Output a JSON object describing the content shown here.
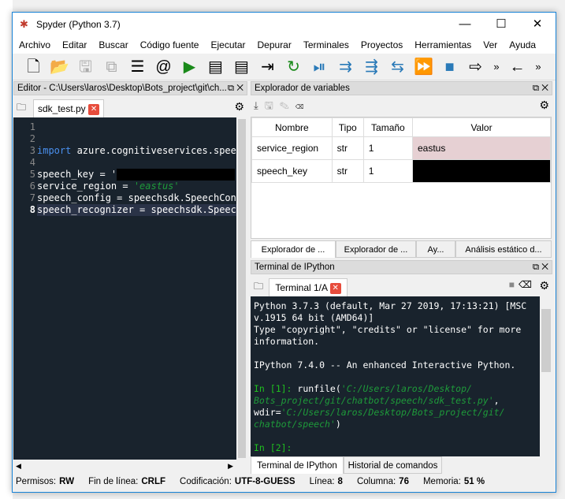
{
  "window": {
    "title": "Spyder (Python 3.7)"
  },
  "menu": [
    "Archivo",
    "Editar",
    "Buscar",
    "Código fuente",
    "Ejecutar",
    "Depurar",
    "Terminales",
    "Proyectos",
    "Herramientas",
    "Ver",
    "Ayuda"
  ],
  "toolbar": [
    {
      "icon": "new-file-icon",
      "glyph": "🗋"
    },
    {
      "icon": "open-folder-icon",
      "glyph": "📂"
    },
    {
      "icon": "save-icon",
      "glyph": "🖫"
    },
    {
      "icon": "save-all-icon",
      "glyph": "⧉"
    },
    {
      "icon": "list-icon",
      "glyph": "☰"
    },
    {
      "icon": "at-icon",
      "glyph": "@"
    },
    {
      "icon": "run-icon",
      "glyph": "▶"
    },
    {
      "icon": "run-cell-icon",
      "glyph": "▤"
    },
    {
      "icon": "run-cell-advance-icon",
      "glyph": "▤"
    },
    {
      "icon": "run-selection-icon",
      "glyph": "⇥"
    },
    {
      "icon": "rerun-icon",
      "glyph": "↻"
    },
    {
      "icon": "debug-icon",
      "glyph": "⏯"
    },
    {
      "icon": "step-icon",
      "glyph": "⇉"
    },
    {
      "icon": "step-into-icon",
      "glyph": "⇶"
    },
    {
      "icon": "step-return-icon",
      "glyph": "⇆"
    },
    {
      "icon": "continue-icon",
      "glyph": "⏩"
    },
    {
      "icon": "stop-icon",
      "glyph": "■"
    },
    {
      "icon": "maximize-pane-icon",
      "glyph": "⇨"
    },
    {
      "icon": "more-icon",
      "glyph": "»"
    },
    {
      "icon": "back-arrow-icon",
      "glyph": "←"
    },
    {
      "icon": "more-icon",
      "glyph": "»"
    }
  ],
  "editor": {
    "header": "Editor - C:\\Users\\laros\\Desktop\\Bots_project\\git\\ch...",
    "tab": "sdk_test.py",
    "lines": [
      {
        "n": "1",
        "code": ""
      },
      {
        "n": "2",
        "code": ""
      },
      {
        "n": "3",
        "kw": "import",
        "code": " azure.cognitiveservices.speec"
      },
      {
        "n": "4",
        "code": ""
      },
      {
        "n": "5",
        "code": "speech_key = '"
      },
      {
        "n": "6",
        "code": "service_region = ",
        "str": "'eastus'"
      },
      {
        "n": "7",
        "code": "speech_config = speechsdk.SpeechConf"
      },
      {
        "n": "8",
        "code": "speech_recognizer = speechsdk.Speech"
      }
    ]
  },
  "varexp": {
    "header": "Explorador de variables",
    "columns": [
      "Nombre",
      "Tipo",
      "Tamaño",
      "Valor"
    ],
    "rows": [
      {
        "name": "service_region",
        "type": "str",
        "size": "1",
        "value": "eastus"
      },
      {
        "name": "speech_key",
        "type": "str",
        "size": "1",
        "value": ""
      }
    ],
    "tabs": [
      "Explorador de ...",
      "Explorador de ...",
      "Ay...",
      "Análisis estático d..."
    ]
  },
  "terminal": {
    "header": "Terminal de IPython",
    "tab": "Terminal 1/A",
    "banner": "Python 3.7.3 (default, Mar 27 2019, 17:13:21) [MSC\nv.1915 64 bit (AMD64)]\nType \"copyright\", \"credits\" or \"license\" for more\ninformation.\n\nIPython 7.4.0 -- An enhanced Interactive Python.\n",
    "in1": "In [1]: ",
    "cmd1": "runfile(",
    "s1": "'C:/Users/laros/Desktop/\nBots_project/git/chatbot/speech/sdk_test.py'",
    "cmd2": ",\nwdir=",
    "s2": "'C:/Users/laros/Desktop/Bots_project/git/\nchatbot/speech'",
    "cmd3": ")",
    "in2": "In [2]:",
    "tabs": [
      "Terminal de IPython",
      "Historial de comandos"
    ]
  },
  "status": {
    "perm_label": "Permisos:",
    "perm": "RW",
    "eol_label": "Fin de línea:",
    "eol": "CRLF",
    "enc_label": "Codificación:",
    "enc": "UTF-8-GUESS",
    "line_label": "Línea:",
    "line": "8",
    "col_label": "Columna:",
    "col": "76",
    "mem_label": "Memoria:",
    "mem": "51 %"
  }
}
